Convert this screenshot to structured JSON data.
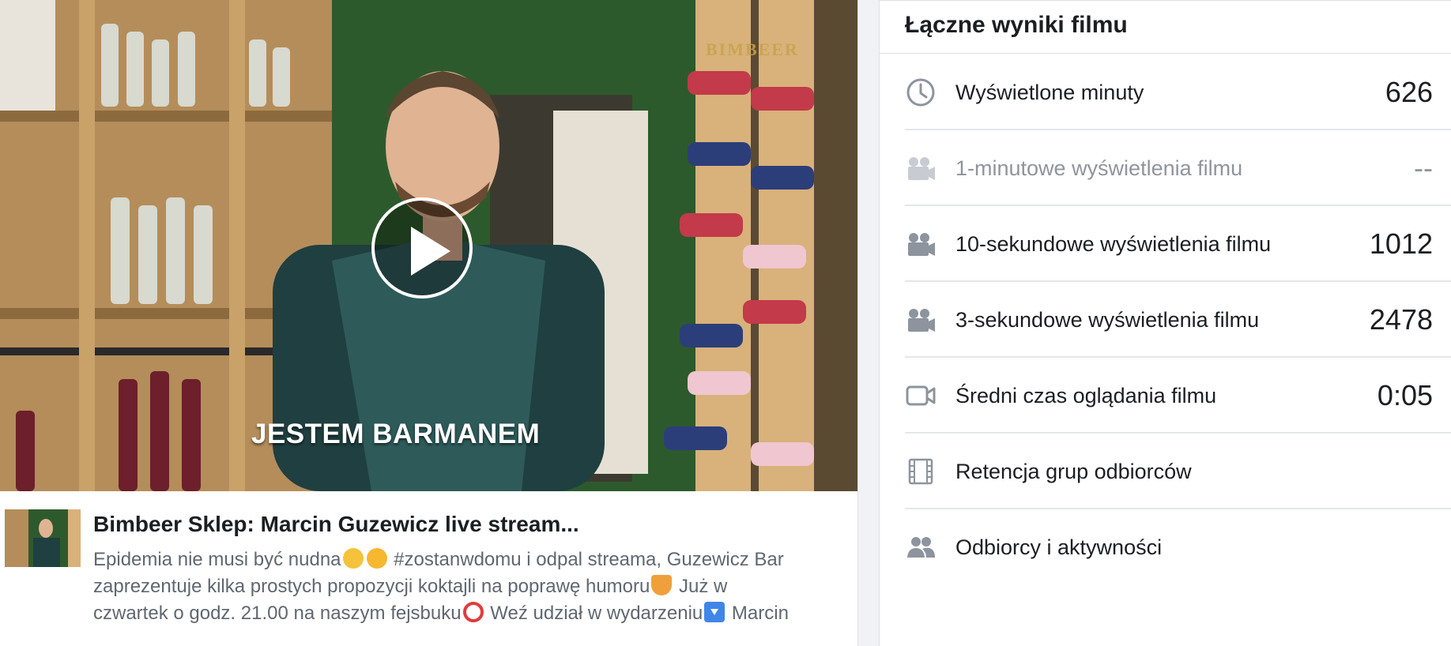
{
  "video": {
    "overlay_caption": "JESTEM BARMANEM",
    "watermark": "BIMBEER"
  },
  "post": {
    "title": "Bimbeer Sklep: Marcin Guzewicz live stream...",
    "description_lines": [
      "Epidemia nie musi być nudna",
      " #zostanwdomu i odpal streama, Guzewicz Bar",
      "zaprezentuje kilka prostych propozycji koktajli na poprawę humoru",
      "  Już w",
      "czwartek o godz. 21.00 na naszym fejsbuku",
      " Weź udział w wydarzeniu",
      " Marcin"
    ]
  },
  "panel": {
    "title": "Łączne wyniki filmu",
    "metrics": [
      {
        "label": "Wyświetlone minuty",
        "value": "626",
        "icon": "clock-icon",
        "dim": false
      },
      {
        "label": "1-minutowe wyświetlenia filmu",
        "value": "--",
        "icon": "film-camera-icon",
        "dim": true
      },
      {
        "label": "10-sekundowe wyświetlenia filmu",
        "value": "1012",
        "icon": "film-camera-icon",
        "dim": false
      },
      {
        "label": "3-sekundowe wyświetlenia filmu",
        "value": "2478",
        "icon": "film-camera-icon",
        "dim": false
      },
      {
        "label": "Średni czas oglądania filmu",
        "value": "0:05",
        "icon": "video-camera-icon",
        "dim": false
      },
      {
        "label": "Retencja grup odbiorców",
        "value": "",
        "icon": "film-strip-icon",
        "dim": false
      },
      {
        "label": "Odbiorcy i aktywności",
        "value": "",
        "icon": "people-icon",
        "dim": false
      }
    ]
  },
  "colors": {
    "text_primary": "#1c1e21",
    "text_secondary": "#606770",
    "text_dim": "#90949c",
    "divider": "#e4e6eb",
    "gutter": "#f0f2f5",
    "icon_gray": "#8d949e"
  }
}
